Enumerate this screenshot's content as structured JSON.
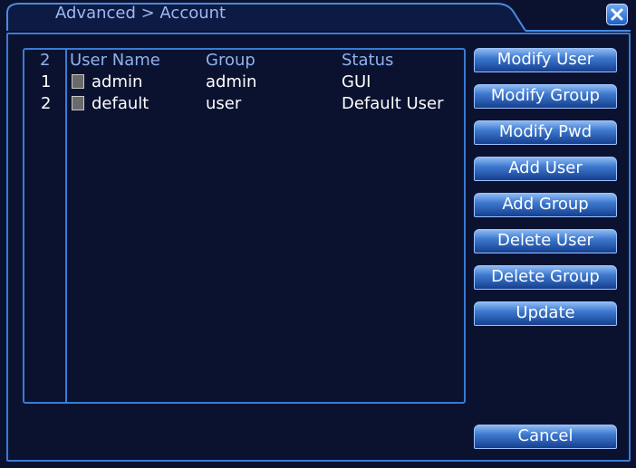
{
  "window": {
    "title": "Advanced > Account"
  },
  "table": {
    "headers": {
      "count": "2",
      "user_name": "User Name",
      "group": "Group",
      "status": "Status"
    },
    "rows": [
      {
        "index": "1",
        "user_name": "admin",
        "group": "admin",
        "status": "GUI"
      },
      {
        "index": "2",
        "user_name": "default",
        "group": "user",
        "status": "Default User"
      }
    ]
  },
  "buttons": {
    "modify_user": "Modify User",
    "modify_group": "Modify Group",
    "modify_pwd": "Modify Pwd",
    "add_user": "Add User",
    "add_group": "Add Group",
    "delete_user": "Delete User",
    "delete_group": "Delete Group",
    "update": "Update",
    "cancel": "Cancel"
  },
  "colors": {
    "background": "#0a1230",
    "frame_border": "#3a7bd5",
    "header_text": "#8fb2ee",
    "row_text": "#ffffff"
  }
}
